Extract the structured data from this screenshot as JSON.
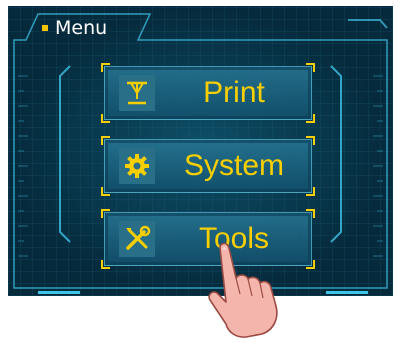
{
  "header": {
    "title": "Menu"
  },
  "menu": {
    "items": [
      {
        "label": "Print",
        "icon": "print-icon"
      },
      {
        "label": "System",
        "icon": "gear-icon"
      },
      {
        "label": "Tools",
        "icon": "tools-icon"
      }
    ]
  },
  "colors": {
    "accent": "#f7cf00",
    "background": "#052a3c",
    "frame": "#3fc3e6"
  }
}
